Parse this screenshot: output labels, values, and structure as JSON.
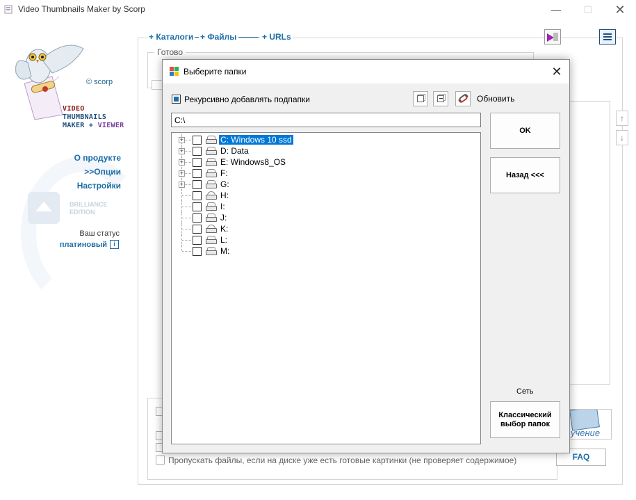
{
  "window": {
    "title": "Video Thumbnails Maker by Scorp",
    "minimize_label": "—",
    "maximize_label": "☐",
    "close_label": "✕"
  },
  "branding": {
    "copyright": "© scorp",
    "line1": "VIDEO",
    "line2": "THUMBNAILS",
    "line3_a": "MAKER + ",
    "line3_b": "VIEWER",
    "edition_line1": "BRILLIANCE",
    "edition_line2": "EDITION"
  },
  "nav": {
    "about": "О продукте",
    "options": ">>Опции",
    "settings": "Настройки"
  },
  "status": {
    "label": "Ваш статус",
    "value": "платиновый",
    "info_glyph": "i"
  },
  "tabs": {
    "catalogs": "+ Каталоги",
    "files": "+ Файлы",
    "urls": "+ URLs"
  },
  "main": {
    "ready_label": "Готово",
    "skip_label": "Пропускать файлы, если на диске уже есть готовые картинки (не проверяет содержимое)",
    "learning_label": "учение",
    "faq_label": "FAQ",
    "arrow_up": "↑",
    "arrow_down": "↓"
  },
  "dialog": {
    "title": "Выберите папки",
    "close_label": "✕",
    "recursive_label": "Рекурсивно добавлять подпапки",
    "refresh_label": "Обновить",
    "path_value": "C:\\",
    "ok_label": "OK",
    "back_label": "Назад <<<",
    "network_label": "Сеть",
    "classic_label": "Классический выбор папок",
    "drives": [
      {
        "label": "C: Windows 10 ssd",
        "expandable": true,
        "selected": true,
        "kind": "hdd"
      },
      {
        "label": "D: Data",
        "expandable": true,
        "selected": false,
        "kind": "hdd"
      },
      {
        "label": "E: Windows8_OS",
        "expandable": true,
        "selected": false,
        "kind": "hdd"
      },
      {
        "label": "F:",
        "expandable": true,
        "selected": false,
        "kind": "hdd"
      },
      {
        "label": "G:",
        "expandable": true,
        "selected": false,
        "kind": "hdd"
      },
      {
        "label": "H:",
        "expandable": false,
        "selected": false,
        "kind": "cd"
      },
      {
        "label": "I:",
        "expandable": false,
        "selected": false,
        "kind": "hdd"
      },
      {
        "label": "J:",
        "expandable": false,
        "selected": false,
        "kind": "hdd"
      },
      {
        "label": "K:",
        "expandable": false,
        "selected": false,
        "kind": "cd"
      },
      {
        "label": "L:",
        "expandable": false,
        "selected": false,
        "kind": "hdd"
      },
      {
        "label": "M:",
        "expandable": false,
        "selected": false,
        "kind": "hdd"
      }
    ]
  },
  "colors": {
    "link_blue": "#1b6ea8",
    "selection": "#0078d7",
    "brand_red": "#8b1a1a",
    "brand_purple": "#7a3da1"
  }
}
